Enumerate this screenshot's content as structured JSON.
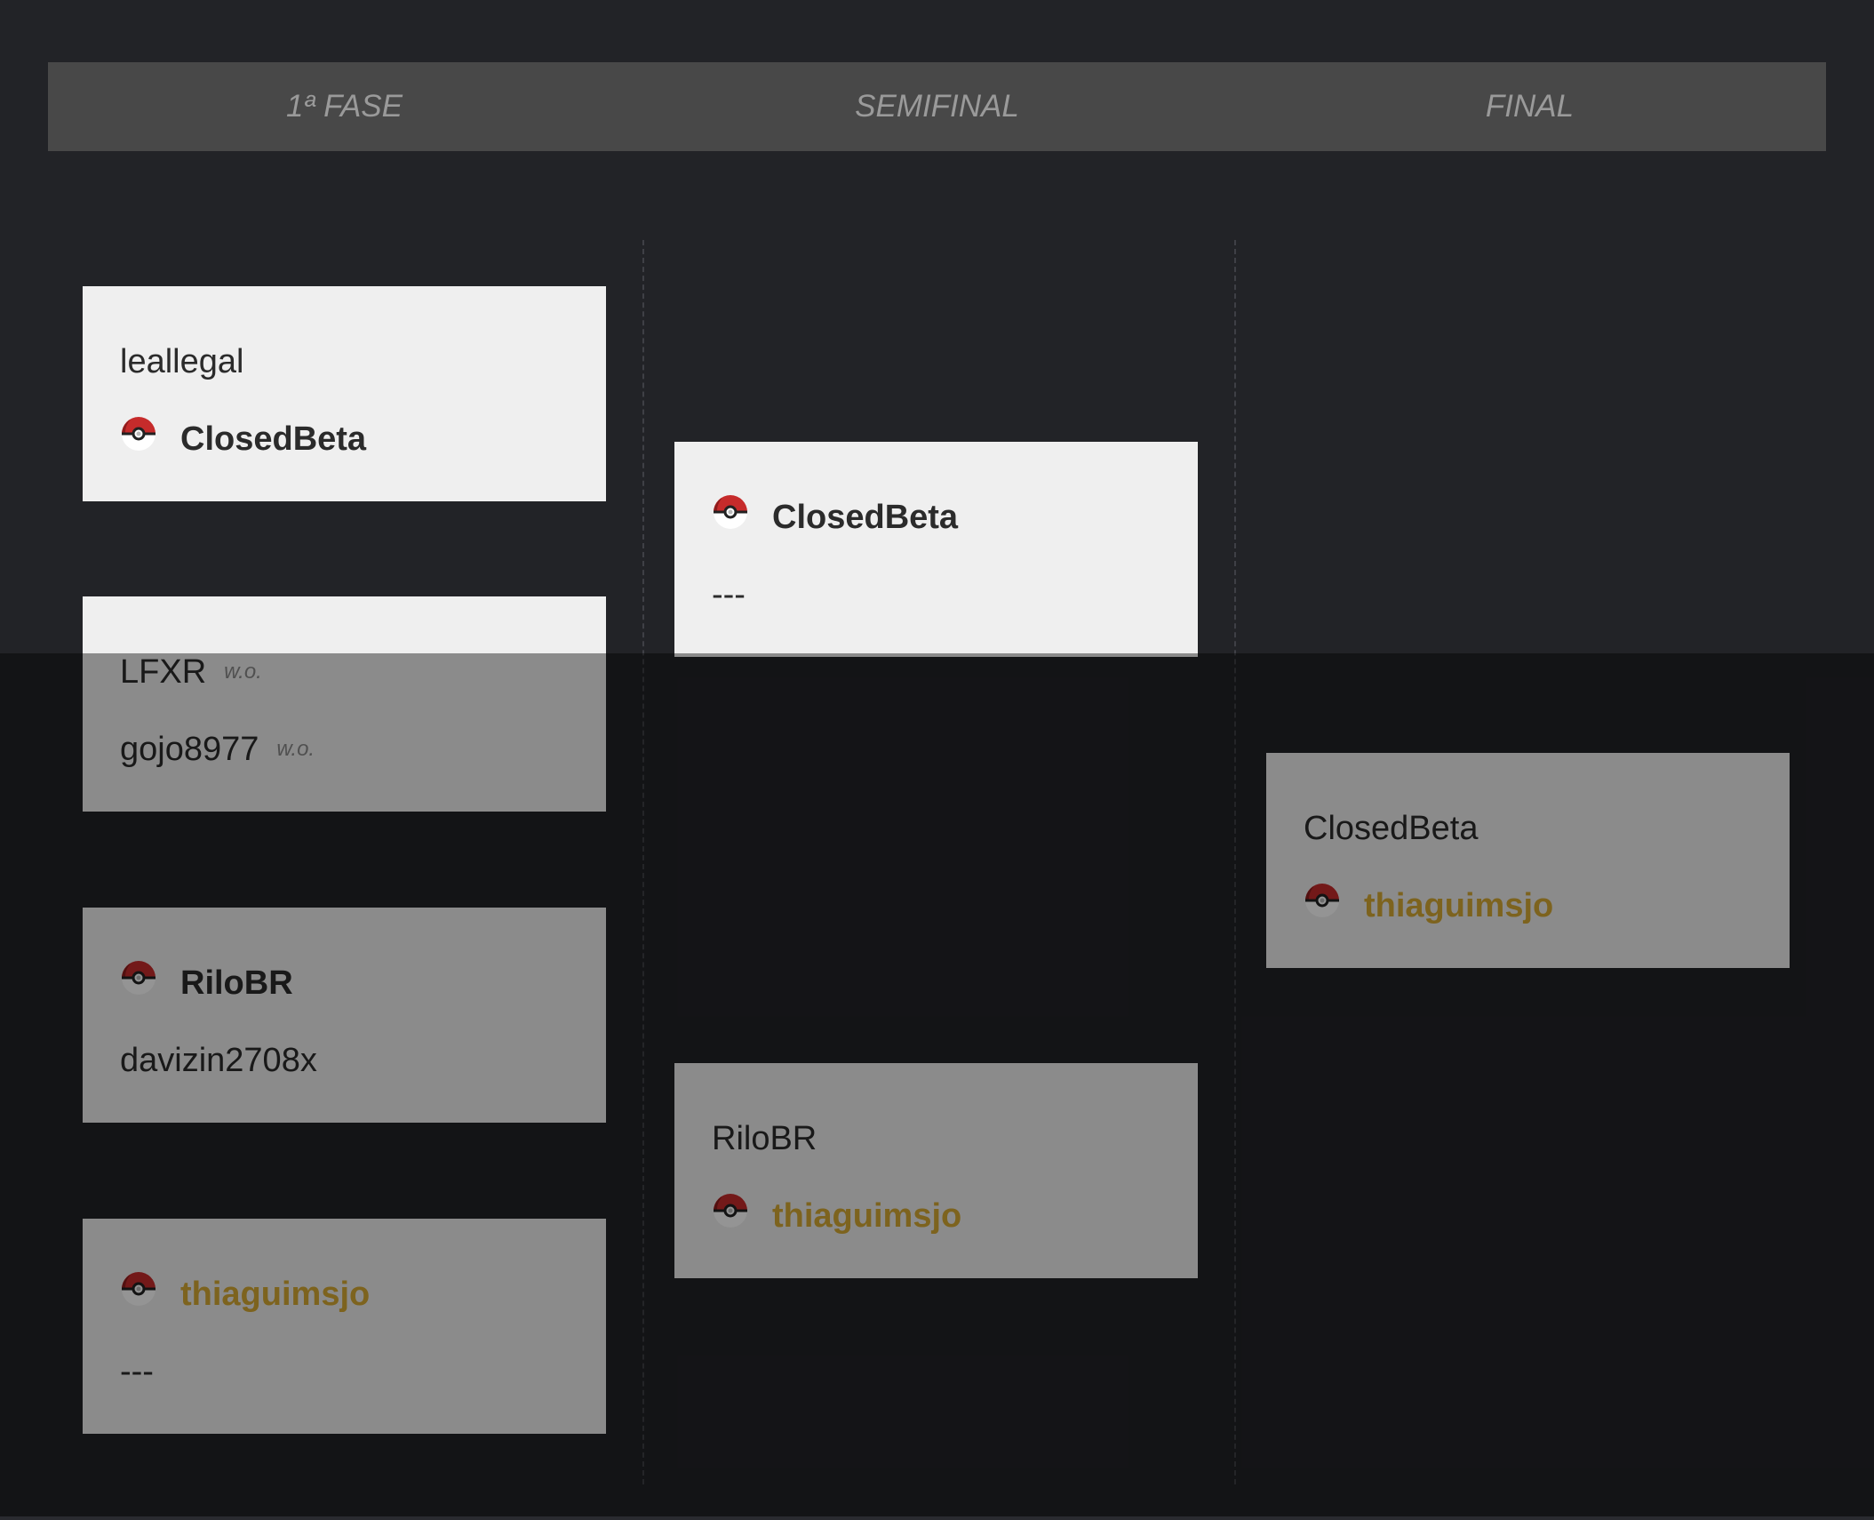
{
  "phases": [
    "1ª FASE",
    "SEMIFINAL",
    "FINAL"
  ],
  "icons": {
    "avatar": "pokeball-icon"
  },
  "colors": {
    "winner_highlight": "#d7ab35",
    "card": "#efefef",
    "header": "#484848"
  },
  "rounds": {
    "first": [
      {
        "top": {
          "name": "leallegal"
        },
        "bottom": {
          "name": "ClosedBeta"
        }
      },
      {
        "top": {
          "name": "LFXR",
          "note": "w.o."
        },
        "bottom": {
          "name": "gojo8977",
          "note": "w.o."
        }
      },
      {
        "top": {
          "name": "RiloBR"
        },
        "bottom": {
          "name": "davizin2708x"
        }
      },
      {
        "top": {
          "name": "thiaguimsjo"
        },
        "bottom": {
          "name": "---"
        }
      }
    ],
    "semifinal": [
      {
        "top": {
          "name": "ClosedBeta"
        },
        "bottom": {
          "name": "---"
        }
      },
      {
        "top": {
          "name": "RiloBR"
        },
        "bottom": {
          "name": "thiaguimsjo"
        }
      }
    ],
    "final": [
      {
        "top": {
          "name": "ClosedBeta"
        },
        "bottom": {
          "name": "thiaguimsjo"
        }
      }
    ]
  }
}
